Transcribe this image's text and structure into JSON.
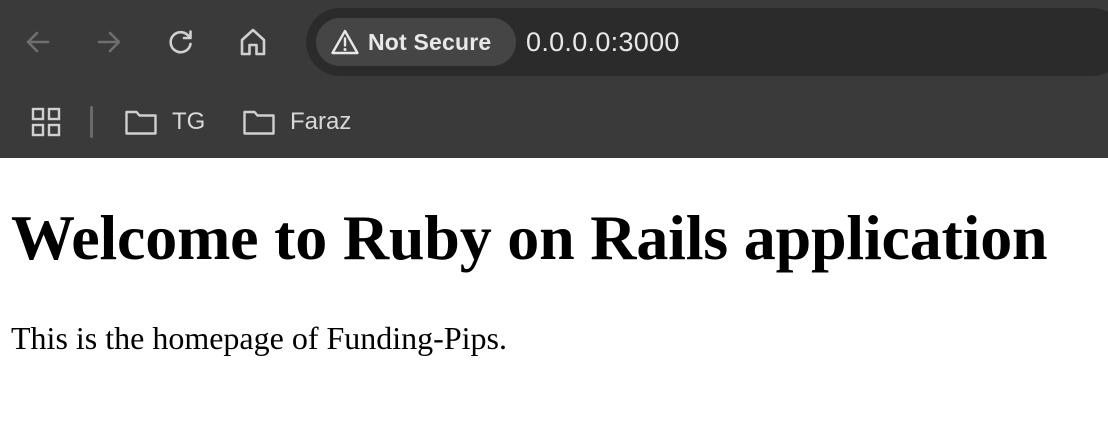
{
  "browser": {
    "nav": {
      "back_icon": "arrow-left-icon",
      "forward_icon": "arrow-right-icon",
      "reload_icon": "reload-icon",
      "home_icon": "home-icon"
    },
    "address_bar": {
      "security_label": "Not Secure",
      "security_icon": "warning-triangle-icon",
      "url": "0.0.0.0:3000"
    },
    "bookmarks": {
      "apps_icon": "apps-grid-icon",
      "items": [
        {
          "label": "TG",
          "icon": "folder-icon"
        },
        {
          "label": "Faraz",
          "icon": "folder-icon"
        }
      ]
    },
    "colors": {
      "chrome_bg": "#3a3a3a",
      "omnibox_bg": "#2b2b2b",
      "chip_bg": "#454545",
      "text": "#e8e8e8"
    }
  },
  "page": {
    "heading": "Welcome to Ruby on Rails application",
    "body": "This is the homepage of Funding-Pips."
  }
}
